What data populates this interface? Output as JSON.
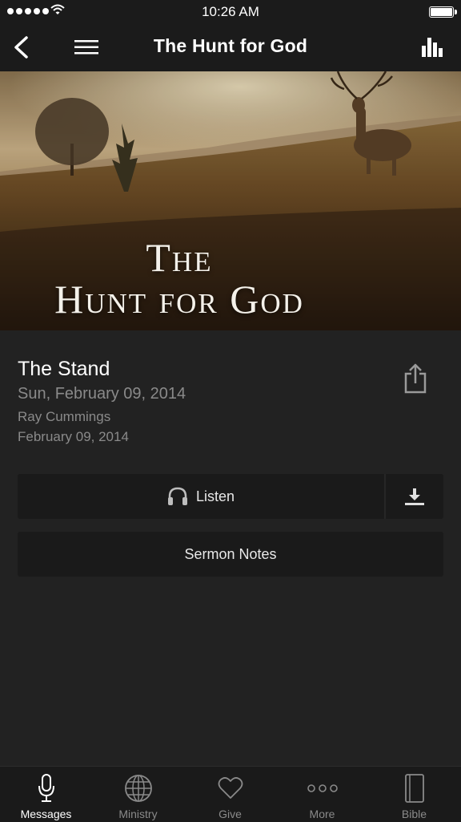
{
  "status_bar": {
    "time": "10:26 AM"
  },
  "nav": {
    "title": "The Hunt for God"
  },
  "hero": {
    "line1": "The",
    "line2": "Hunt for God"
  },
  "message": {
    "title": "The Stand",
    "date": "Sun, February 09, 2014",
    "speaker": "Ray Cummings",
    "published": "February 09, 2014"
  },
  "actions": {
    "listen_label": "Listen",
    "notes_label": "Sermon Notes"
  },
  "tabs": [
    {
      "label": "Messages",
      "icon": "microphone-icon",
      "active": true
    },
    {
      "label": "Ministry",
      "icon": "globe-icon"
    },
    {
      "label": "Give",
      "icon": "heart-icon"
    },
    {
      "label": "More",
      "icon": "more-dots-icon"
    },
    {
      "label": "Bible",
      "icon": "book-icon"
    }
  ],
  "colors": {
    "background": "#222222",
    "bar": "#1a1a1a",
    "muted_text": "#8a8a8a"
  }
}
